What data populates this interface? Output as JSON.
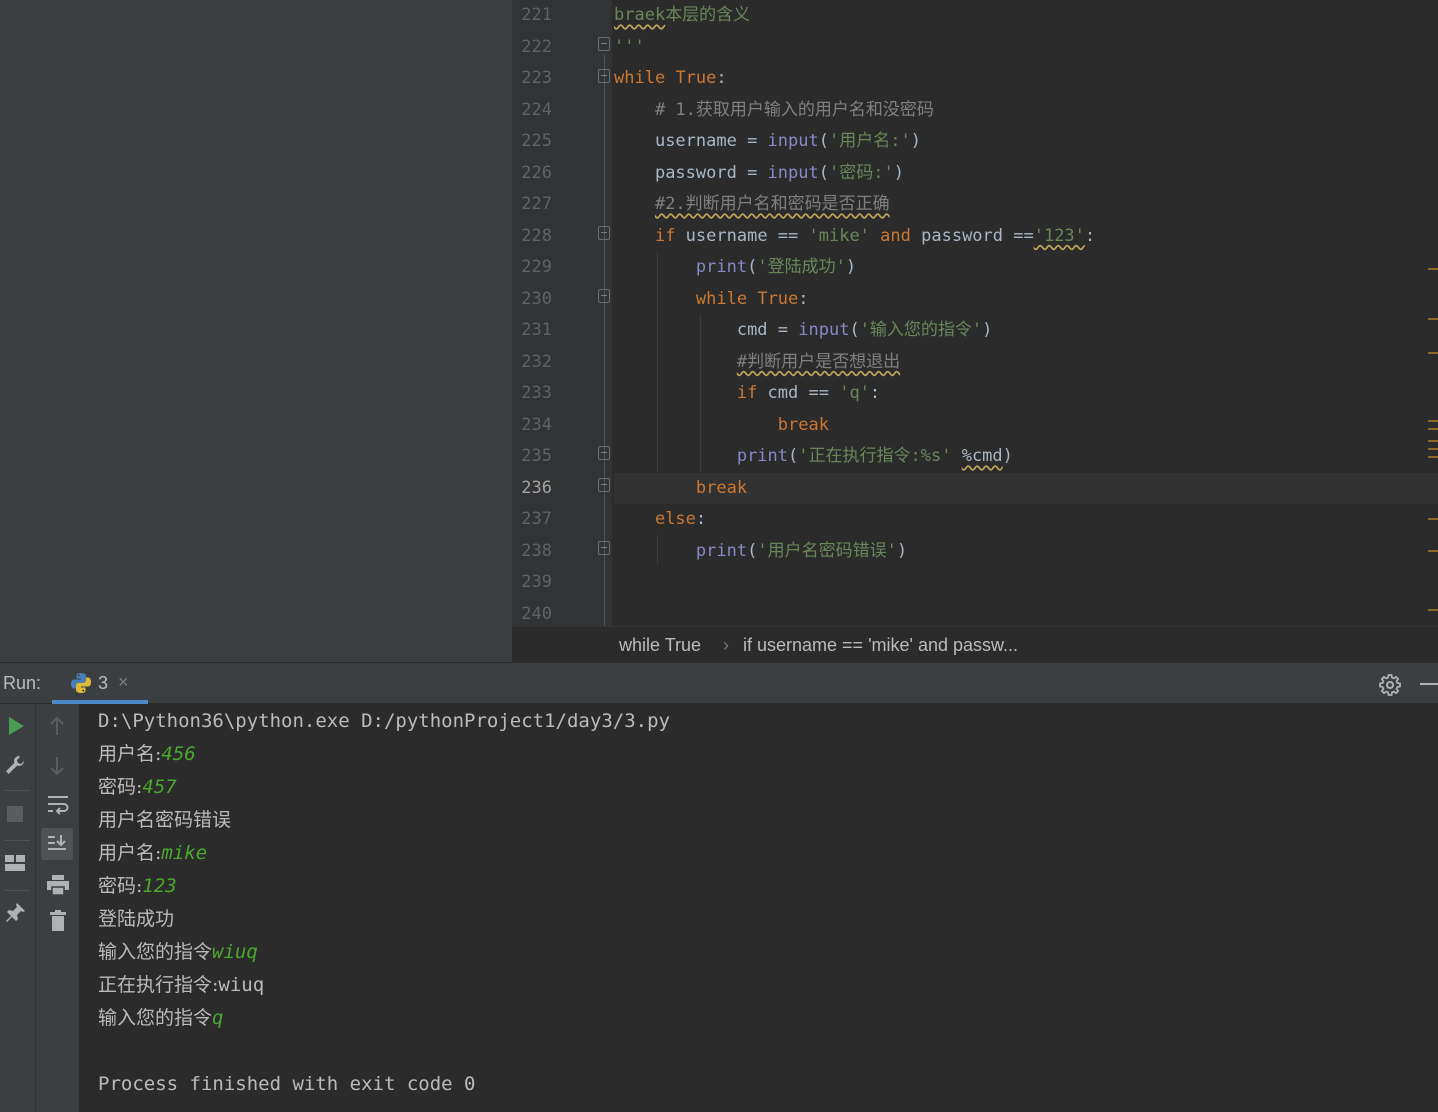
{
  "editor": {
    "line_numbers": [
      "221",
      "222",
      "223",
      "224",
      "225",
      "226",
      "227",
      "228",
      "229",
      "230",
      "231",
      "232",
      "233",
      "234",
      "235",
      "236",
      "237",
      "238",
      "239",
      "240"
    ],
    "current_line": "236",
    "code": {
      "l221_a": "braek",
      "l221_b": "本层的含义",
      "l222": "'''",
      "l223_kw": "while",
      "l223_true": "True",
      "l223_colon": ":",
      "l224": "# 1.获取用户输入的用户名和没密码",
      "l225_var": "username = ",
      "l225_fn": "input",
      "l225_str": "'用户名:'",
      "l226_var": "password = ",
      "l226_fn": "input",
      "l226_str": "'密码:'",
      "l227": "#2.判断用户名和密码是否正确",
      "l228_if": "if",
      "l228_a": " username == ",
      "l228_mike": "'mike'",
      "l228_and": "and",
      "l228_b": " password ==",
      "l228_123": "'123'",
      "l228_colon": ":",
      "l229_fn": "print",
      "l229_str": "'登陆成功'",
      "l230_kw": "while",
      "l230_true": "True",
      "l231_var": "cmd = ",
      "l231_fn": "input",
      "l231_str": "'输入您的指令'",
      "l232": "#判断用户是否想退出",
      "l233_if": "if",
      "l233_a": " cmd == ",
      "l233_q": "'q'",
      "l234": "break",
      "l235_fn": "print",
      "l235_str": "'正在执行指令:%s'",
      "l235_b": "%cmd",
      "l236": "break",
      "l237": "else",
      "l238_fn": "print",
      "l238_str": "'用户名密码错误'"
    }
  },
  "breadcrumb": {
    "item1": "while True",
    "separator": "›",
    "item2": "if username == 'mike' and passw..."
  },
  "run": {
    "label": "Run:",
    "tab_label": "3",
    "tab_close": "×"
  },
  "console": {
    "command": "D:\\Python36\\python.exe D:/pythonProject1/day3/3.py",
    "lines": [
      {
        "prompt": "用户名:",
        "input": "456"
      },
      {
        "prompt": "密码:",
        "input": "457"
      },
      {
        "prompt": "用户名密码错误",
        "input": ""
      },
      {
        "prompt": "用户名:",
        "input": "mike"
      },
      {
        "prompt": "密码:",
        "input": "123"
      },
      {
        "prompt": "登陆成功",
        "input": ""
      },
      {
        "prompt": "输入您的指令",
        "input": "wiuq"
      },
      {
        "prompt": "正在执行指令:",
        "input": ""
      },
      {
        "prompt": "输入您的指令",
        "input": "q"
      }
    ],
    "exec_output": "wiuq",
    "finished": "Process finished with exit code 0"
  },
  "icons": [
    "python-icon",
    "settings-gear-icon",
    "minimize-icon",
    "run-icon",
    "wrench-icon",
    "stop-icon",
    "layout-icon",
    "pin-icon",
    "arrow-up-icon",
    "arrow-down-icon",
    "soft-wrap-icon",
    "scroll-to-end-icon",
    "print-icon",
    "trash-icon"
  ],
  "colors": {
    "keyword": "#cc7832",
    "builtin": "#8888c6",
    "string": "#6a8759",
    "comment": "#808080",
    "console_input": "#4aa82d",
    "accent": "#4a88c7"
  }
}
